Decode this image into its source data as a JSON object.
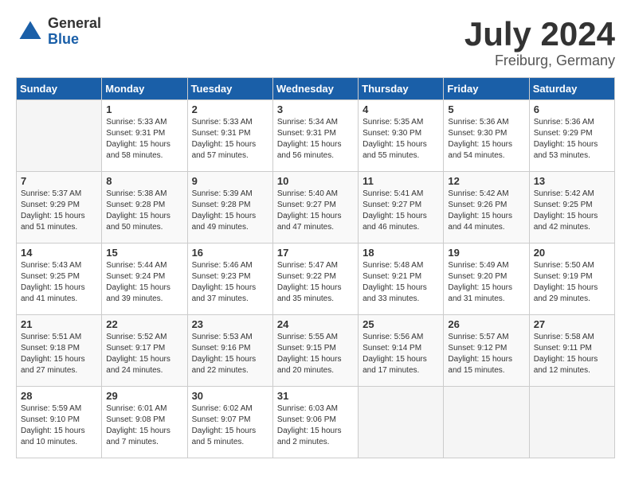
{
  "logo": {
    "general": "General",
    "blue": "Blue"
  },
  "title": {
    "month_year": "July 2024",
    "location": "Freiburg, Germany"
  },
  "headers": [
    "Sunday",
    "Monday",
    "Tuesday",
    "Wednesday",
    "Thursday",
    "Friday",
    "Saturday"
  ],
  "weeks": [
    {
      "days": [
        {
          "num": "",
          "info": ""
        },
        {
          "num": "1",
          "info": "Sunrise: 5:33 AM\nSunset: 9:31 PM\nDaylight: 15 hours\nand 58 minutes."
        },
        {
          "num": "2",
          "info": "Sunrise: 5:33 AM\nSunset: 9:31 PM\nDaylight: 15 hours\nand 57 minutes."
        },
        {
          "num": "3",
          "info": "Sunrise: 5:34 AM\nSunset: 9:31 PM\nDaylight: 15 hours\nand 56 minutes."
        },
        {
          "num": "4",
          "info": "Sunrise: 5:35 AM\nSunset: 9:30 PM\nDaylight: 15 hours\nand 55 minutes."
        },
        {
          "num": "5",
          "info": "Sunrise: 5:36 AM\nSunset: 9:30 PM\nDaylight: 15 hours\nand 54 minutes."
        },
        {
          "num": "6",
          "info": "Sunrise: 5:36 AM\nSunset: 9:29 PM\nDaylight: 15 hours\nand 53 minutes."
        }
      ]
    },
    {
      "days": [
        {
          "num": "7",
          "info": "Sunrise: 5:37 AM\nSunset: 9:29 PM\nDaylight: 15 hours\nand 51 minutes."
        },
        {
          "num": "8",
          "info": "Sunrise: 5:38 AM\nSunset: 9:28 PM\nDaylight: 15 hours\nand 50 minutes."
        },
        {
          "num": "9",
          "info": "Sunrise: 5:39 AM\nSunset: 9:28 PM\nDaylight: 15 hours\nand 49 minutes."
        },
        {
          "num": "10",
          "info": "Sunrise: 5:40 AM\nSunset: 9:27 PM\nDaylight: 15 hours\nand 47 minutes."
        },
        {
          "num": "11",
          "info": "Sunrise: 5:41 AM\nSunset: 9:27 PM\nDaylight: 15 hours\nand 46 minutes."
        },
        {
          "num": "12",
          "info": "Sunrise: 5:42 AM\nSunset: 9:26 PM\nDaylight: 15 hours\nand 44 minutes."
        },
        {
          "num": "13",
          "info": "Sunrise: 5:42 AM\nSunset: 9:25 PM\nDaylight: 15 hours\nand 42 minutes."
        }
      ]
    },
    {
      "days": [
        {
          "num": "14",
          "info": "Sunrise: 5:43 AM\nSunset: 9:25 PM\nDaylight: 15 hours\nand 41 minutes."
        },
        {
          "num": "15",
          "info": "Sunrise: 5:44 AM\nSunset: 9:24 PM\nDaylight: 15 hours\nand 39 minutes."
        },
        {
          "num": "16",
          "info": "Sunrise: 5:46 AM\nSunset: 9:23 PM\nDaylight: 15 hours\nand 37 minutes."
        },
        {
          "num": "17",
          "info": "Sunrise: 5:47 AM\nSunset: 9:22 PM\nDaylight: 15 hours\nand 35 minutes."
        },
        {
          "num": "18",
          "info": "Sunrise: 5:48 AM\nSunset: 9:21 PM\nDaylight: 15 hours\nand 33 minutes."
        },
        {
          "num": "19",
          "info": "Sunrise: 5:49 AM\nSunset: 9:20 PM\nDaylight: 15 hours\nand 31 minutes."
        },
        {
          "num": "20",
          "info": "Sunrise: 5:50 AM\nSunset: 9:19 PM\nDaylight: 15 hours\nand 29 minutes."
        }
      ]
    },
    {
      "days": [
        {
          "num": "21",
          "info": "Sunrise: 5:51 AM\nSunset: 9:18 PM\nDaylight: 15 hours\nand 27 minutes."
        },
        {
          "num": "22",
          "info": "Sunrise: 5:52 AM\nSunset: 9:17 PM\nDaylight: 15 hours\nand 24 minutes."
        },
        {
          "num": "23",
          "info": "Sunrise: 5:53 AM\nSunset: 9:16 PM\nDaylight: 15 hours\nand 22 minutes."
        },
        {
          "num": "24",
          "info": "Sunrise: 5:55 AM\nSunset: 9:15 PM\nDaylight: 15 hours\nand 20 minutes."
        },
        {
          "num": "25",
          "info": "Sunrise: 5:56 AM\nSunset: 9:14 PM\nDaylight: 15 hours\nand 17 minutes."
        },
        {
          "num": "26",
          "info": "Sunrise: 5:57 AM\nSunset: 9:12 PM\nDaylight: 15 hours\nand 15 minutes."
        },
        {
          "num": "27",
          "info": "Sunrise: 5:58 AM\nSunset: 9:11 PM\nDaylight: 15 hours\nand 12 minutes."
        }
      ]
    },
    {
      "days": [
        {
          "num": "28",
          "info": "Sunrise: 5:59 AM\nSunset: 9:10 PM\nDaylight: 15 hours\nand 10 minutes."
        },
        {
          "num": "29",
          "info": "Sunrise: 6:01 AM\nSunset: 9:08 PM\nDaylight: 15 hours\nand 7 minutes."
        },
        {
          "num": "30",
          "info": "Sunrise: 6:02 AM\nSunset: 9:07 PM\nDaylight: 15 hours\nand 5 minutes."
        },
        {
          "num": "31",
          "info": "Sunrise: 6:03 AM\nSunset: 9:06 PM\nDaylight: 15 hours\nand 2 minutes."
        },
        {
          "num": "",
          "info": ""
        },
        {
          "num": "",
          "info": ""
        },
        {
          "num": "",
          "info": ""
        }
      ]
    }
  ]
}
